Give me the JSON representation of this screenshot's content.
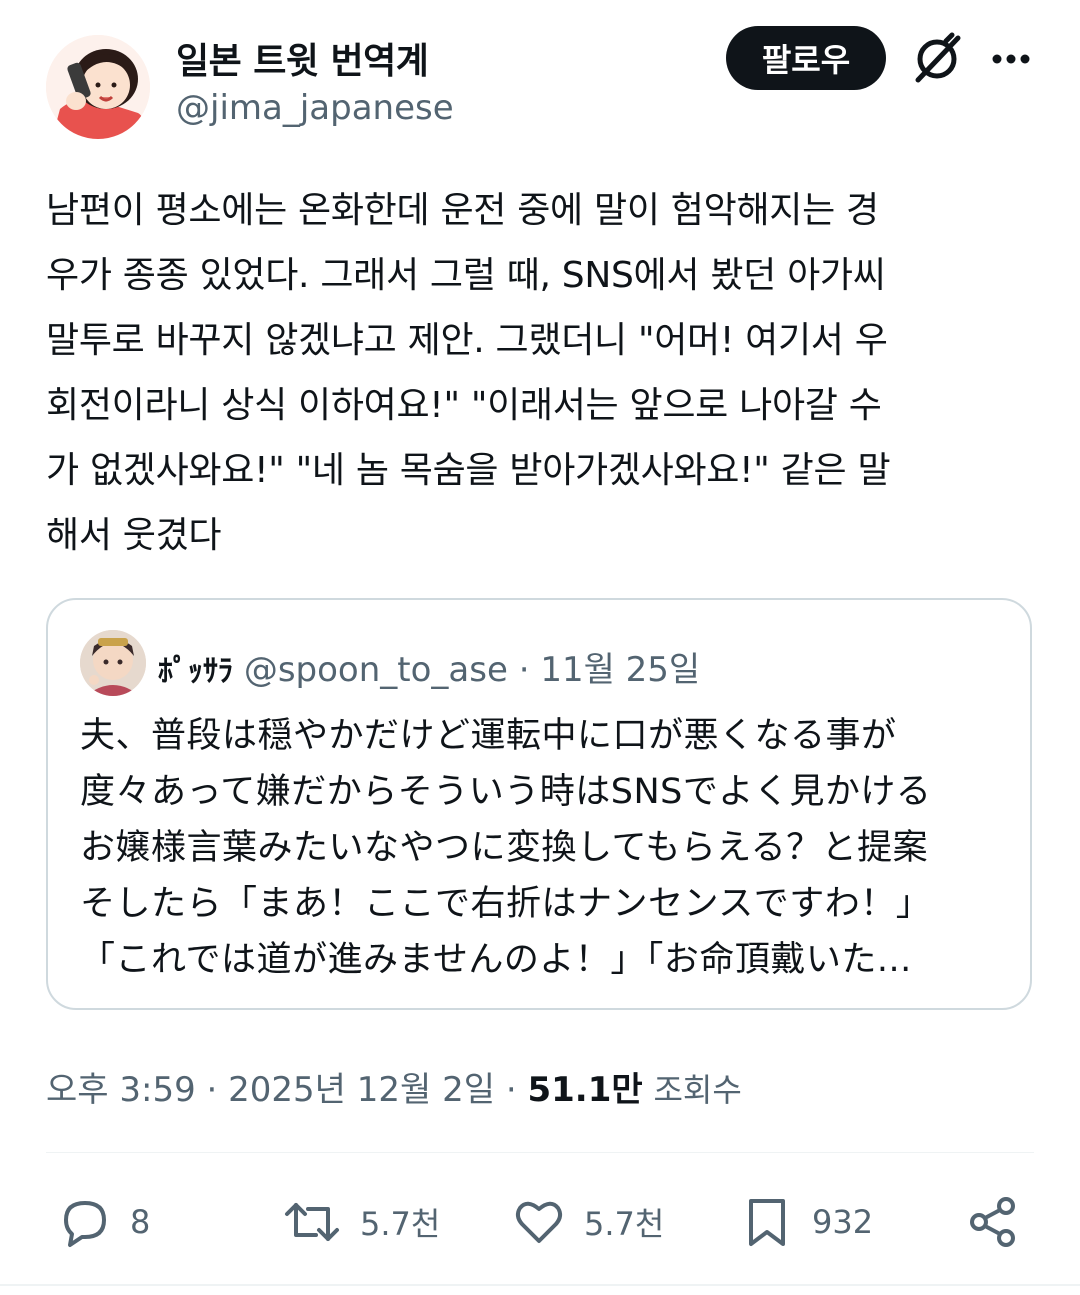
{
  "author": {
    "display_name": "일본 트윗 번역계",
    "handle": "@jima_japanese",
    "avatar_icon": "woman-phone-avatar"
  },
  "header": {
    "follow_label": "팔로우",
    "grok_icon": "grok-icon",
    "more_icon": "more-icon"
  },
  "post": {
    "text": "남편이 평소에는 온화한데 운전 중에 말이 험악해지는 경\n우가 종종 있었다. 그래서 그럴 때, SNS에서 봤던 아가씨\n말투로 바꾸지 않겠냐고 제안. 그랬더니 \"어머! 여기서 우\n회전이라니 상식 이하여요!\" \"이래서는 앞으로 나아갈 수\n가 없겠사와요!\" \"네 놈 목숨을 받아가겠사와요!\" 같은 말\n해서 웃겼다"
  },
  "quote": {
    "display_name": "ﾎﾟｯｻﾗ",
    "handle": "@spoon_to_ase",
    "separator": "·",
    "date": "11월 25일",
    "text": "夫、普段は穏やかだけど運転中に口が悪くなる事が\n度々あって嫌だからそういう時はSNSでよく見かける\nお嬢様言葉みたいなやつに変換してもらえる？と提案\nそしたら「まあ！ここで右折はナンセンスですわ！」\n「これでは道が進みませんのよ！」「お命頂戴いた..."
  },
  "meta": {
    "time": "오후 3:59",
    "date": "2025년 12월 2일",
    "separator": "·",
    "views_count": "51.1만",
    "views_label": "조회수"
  },
  "actions": {
    "reply_count": "8",
    "repost_count": "5.7천",
    "like_count": "5.7천",
    "bookmark_count": "932"
  },
  "colors": {
    "text": "#0f1419",
    "secondary": "#536471",
    "border": "#cfd9de",
    "follow_bg": "#0f1419"
  }
}
